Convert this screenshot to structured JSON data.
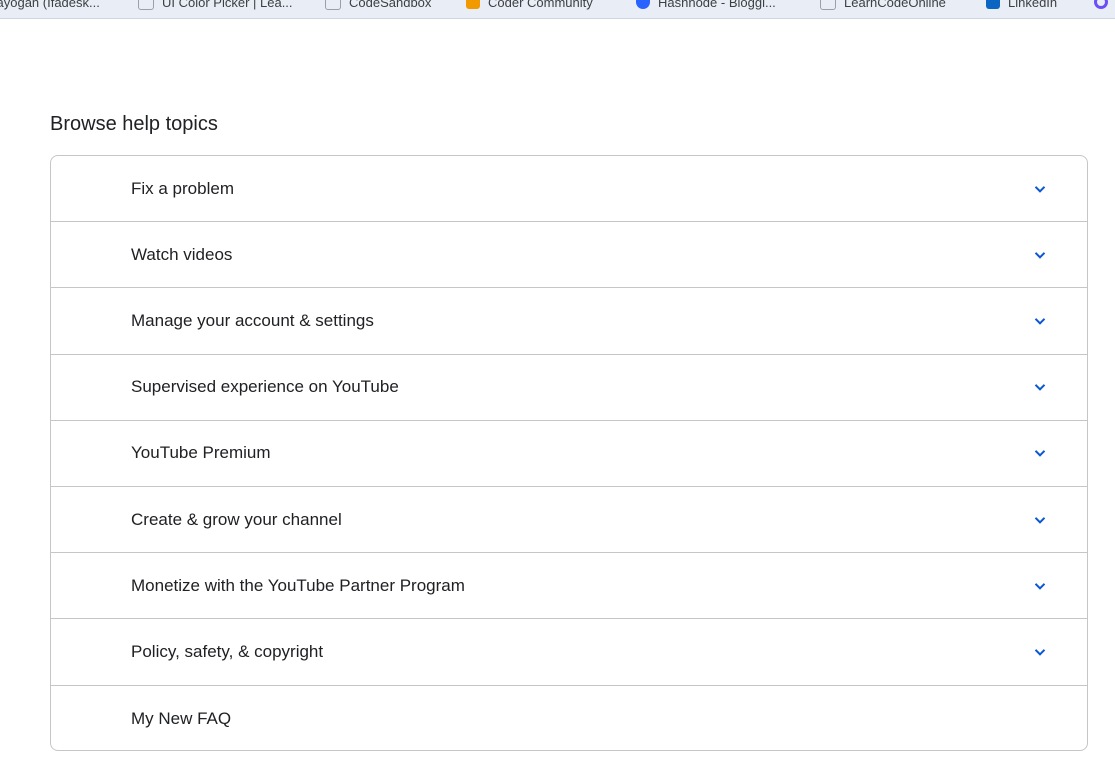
{
  "bookmarks": [
    {
      "label": "Jayogan (Ifadesk...",
      "color": "#5f6368"
    },
    {
      "label": "UI Color Picker | Lea...",
      "color": "#9aa0a6"
    },
    {
      "label": "CodeSandbox",
      "color": "#9aa0a6"
    },
    {
      "label": "Coder Community",
      "color": "#f29900"
    },
    {
      "label": "Hashnode - Bloggi...",
      "color": "#2962ff"
    },
    {
      "label": "LearnCodeOnline",
      "color": "#9aa0a6"
    },
    {
      "label": "LinkedIn",
      "color": "#0a66c2"
    }
  ],
  "help": {
    "title": "Browse help topics",
    "topics": [
      {
        "label": "Fix a problem",
        "icon": "chevron-down-icon"
      },
      {
        "label": "Watch videos",
        "icon": "chevron-down-icon"
      },
      {
        "label": "Manage your account & settings",
        "icon": "chevron-down-icon"
      },
      {
        "label": "Supervised experience on YouTube",
        "icon": "chevron-down-icon"
      },
      {
        "label": "YouTube Premium",
        "icon": "chevron-down-icon"
      },
      {
        "label": "Create & grow your channel",
        "icon": "chevron-down-icon"
      },
      {
        "label": "Monetize with the YouTube Partner Program",
        "icon": "chevron-down-icon"
      },
      {
        "label": "Policy, safety, & copyright",
        "icon": "chevron-down-icon"
      },
      {
        "label": "My New FAQ"
      }
    ]
  },
  "colors": {
    "accent": "#0b57d0",
    "text": "#202124",
    "border": "#c4c7c5"
  }
}
